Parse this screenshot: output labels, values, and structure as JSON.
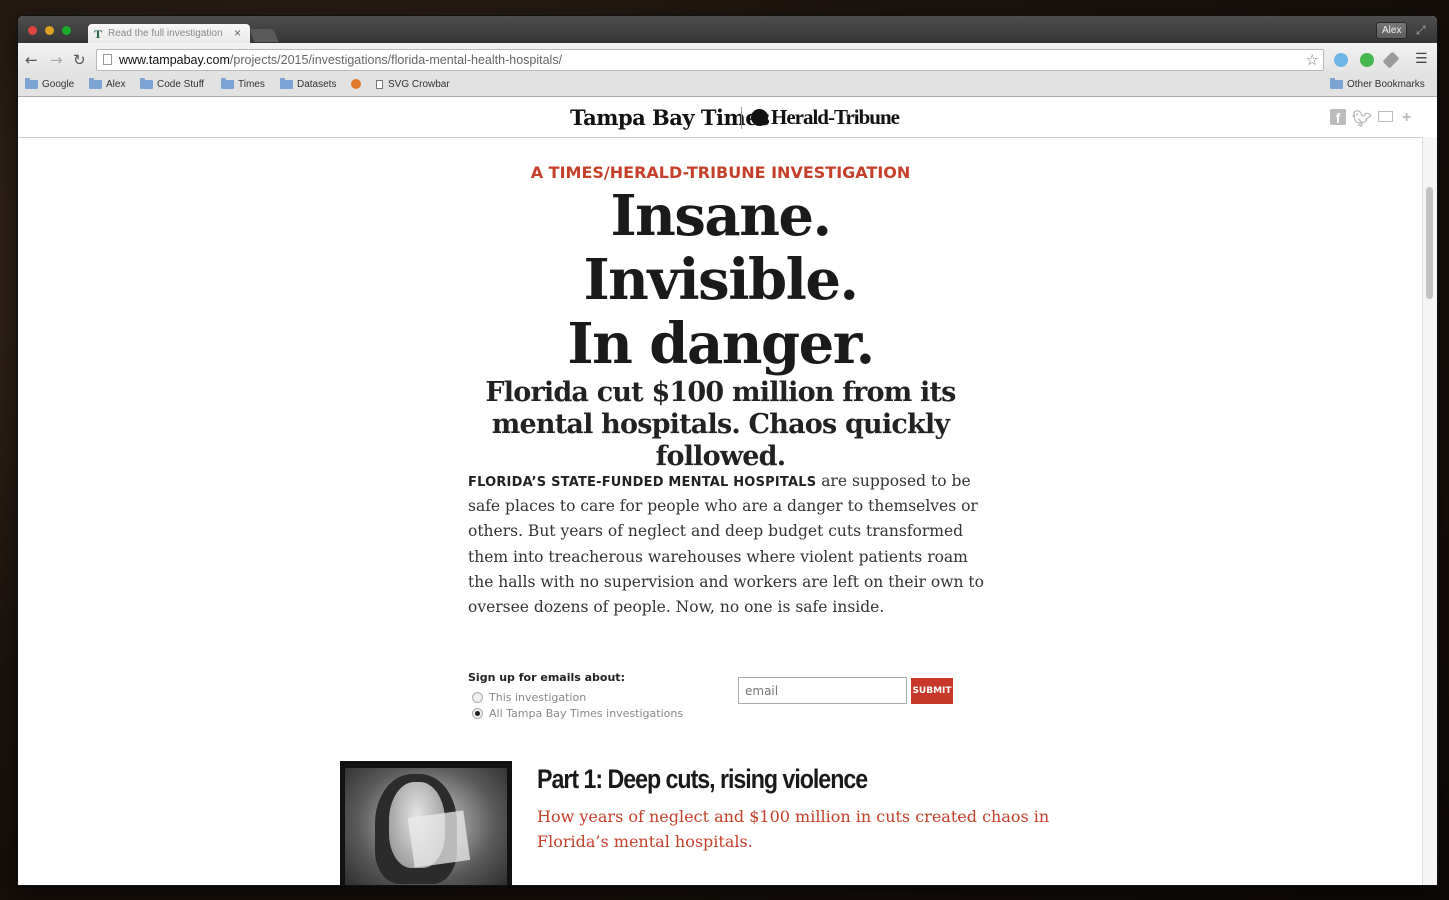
{
  "browser": {
    "tab_title": "Read the full investigation",
    "tab_favicon": "T",
    "user_badge": "Alex",
    "url_host": "www.tampabay.com",
    "url_path": "/projects/2015/investigations/florida-mental-health-hospitals/",
    "bookmarks": [
      "Google",
      "Alex",
      "Code Stuff",
      "Times",
      "Datasets",
      "SVG Crowbar"
    ],
    "other_bookmarks": "Other Bookmarks",
    "icons": [
      "back-icon",
      "forward-icon",
      "reload-icon",
      "star-icon",
      "menu-icon"
    ]
  },
  "masthead": {
    "logo_times": "Tampa Bay Times",
    "logo_herald": "Herald-Tribune"
  },
  "article": {
    "kicker": "A TIMES/HERALD-TRIBUNE INVESTIGATION",
    "headline_lines": [
      "Insane.",
      "Invisible.",
      "In danger."
    ],
    "dek": "Florida cut $100 million from its mental hospitals. Chaos quickly followed.",
    "intro_lead": "FLORIDA’S STATE-FUNDED MENTAL HOSPITALS",
    "intro_body": " are supposed to be safe places to care for people who are a danger to themselves or others. But years of neglect and deep budget cuts transformed them into treacherous warehouses where violent patients roam the halls with no supervision and workers are left on their own to oversee dozens of people. Now, no one is safe inside."
  },
  "signup": {
    "label": "Sign up for emails about:",
    "options": [
      "This investigation",
      "All Tampa Bay Times investigations"
    ],
    "selected_index": 1,
    "email_placeholder": "email",
    "submit_label": "SUBMIT"
  },
  "parts": [
    {
      "title": "Part 1: Deep cuts, rising violence",
      "dek": "How years of neglect and $100 million in cuts created chaos in Florida’s mental hospitals."
    }
  ],
  "colors": {
    "accent": "#c5402a",
    "submit": "#c5382a",
    "headline": "#1a1a1a"
  }
}
